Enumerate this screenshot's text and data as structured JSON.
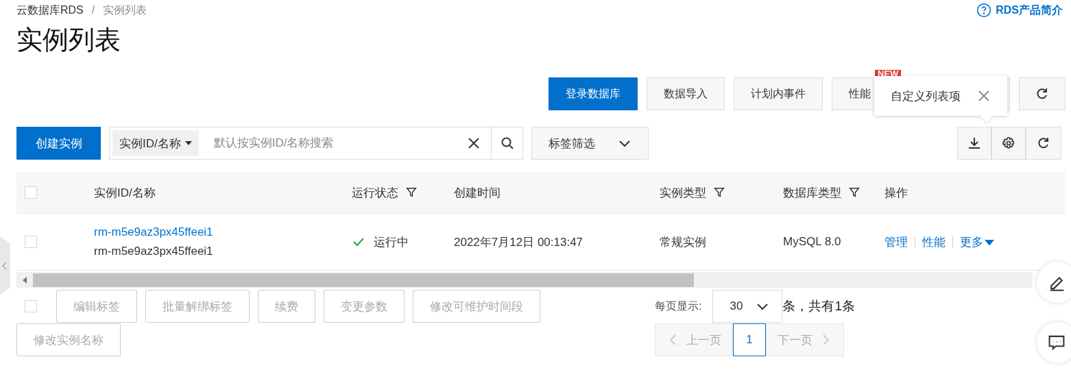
{
  "breadcrumb": {
    "items": [
      "云数据库RDS",
      "实例列表"
    ],
    "separator": "/"
  },
  "help_link": "RDS产品简介",
  "title": "实例列表",
  "toolbar": [
    {
      "label": "登录数据库",
      "primary": true
    },
    {
      "label": "数据导入",
      "primary": false
    },
    {
      "label": "计划内事件",
      "primary": false
    },
    {
      "label": "性能",
      "primary": false,
      "badge": "NEW"
    }
  ],
  "popover": {
    "text": "自定义列表项"
  },
  "create_button": "创建实例",
  "search": {
    "scope": "实例ID/名称",
    "placeholder": "默认按实例ID/名称搜索"
  },
  "tag_filter": "标签筛选",
  "table": {
    "all_checked": false,
    "columns": [
      {
        "label": "实例ID/名称",
        "filter": false
      },
      {
        "label": "运行状态",
        "filter": true
      },
      {
        "label": "创建时间",
        "filter": false
      },
      {
        "label": "实例类型",
        "filter": true
      },
      {
        "label": "数据库类型",
        "filter": true
      },
      {
        "label": "操作",
        "filter": false
      }
    ],
    "rows": [
      {
        "checked": false,
        "id": "rm-m5e9az3px45ffeei1",
        "name": "rm-m5e9az3px45ffeei1",
        "status": "运行中",
        "created": "2022年7月12日 00:13:47",
        "type": "常规实例",
        "db_type": "MySQL 8.0",
        "actions": [
          "管理",
          "性能",
          "更多"
        ]
      }
    ]
  },
  "batch": {
    "checked": false,
    "buttons": [
      {
        "label": "编辑标签",
        "disabled": true
      },
      {
        "label": "批量解绑标签",
        "disabled": true
      },
      {
        "label": "续费",
        "disabled": true
      },
      {
        "label": "变更参数",
        "disabled": true
      },
      {
        "label": "修改可维护时间段",
        "disabled": true
      },
      {
        "label": "修改实例名称",
        "disabled": true
      }
    ]
  },
  "page_size": {
    "label": "每页显示:",
    "value": "30",
    "summary": "条，共有1条"
  },
  "pagination": {
    "prev": "上一页",
    "next": "下一页",
    "prev_disabled": true,
    "next_disabled": true,
    "pages": [
      {
        "label": "1",
        "selected": true
      }
    ]
  }
}
